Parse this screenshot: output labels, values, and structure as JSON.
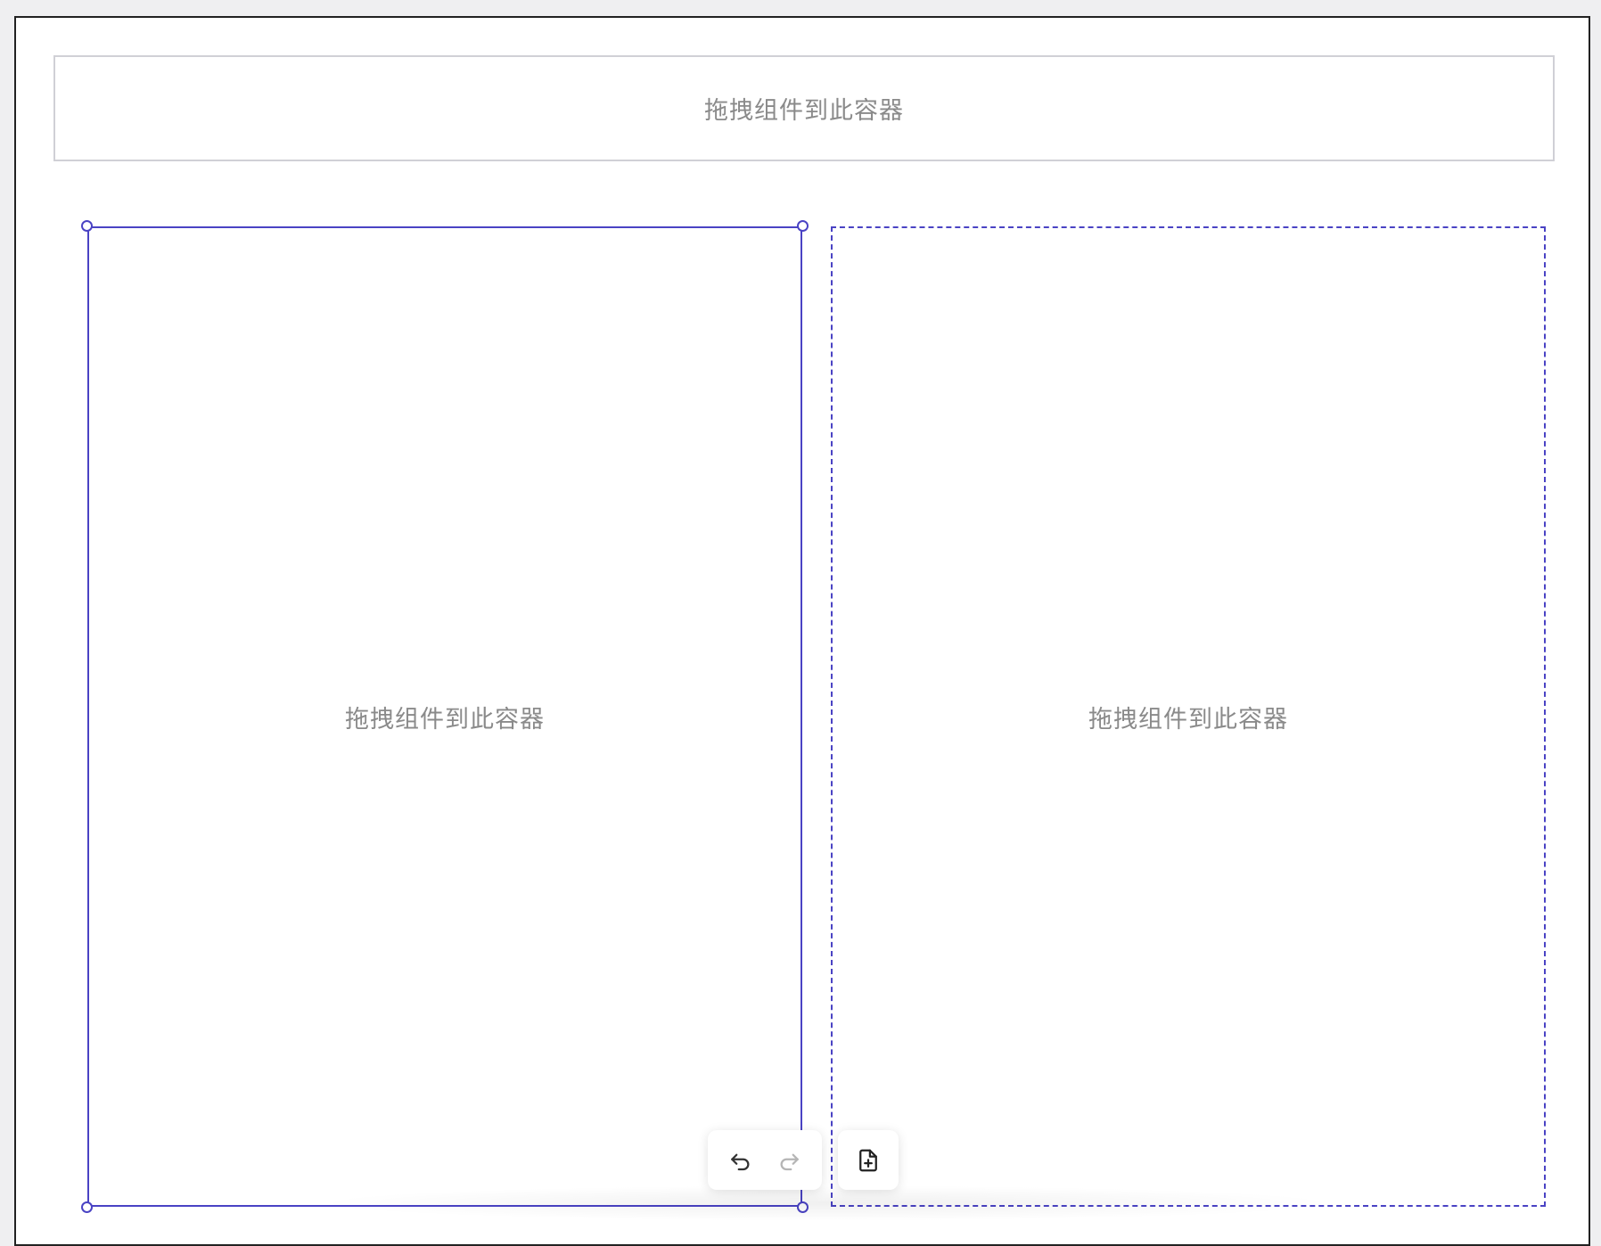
{
  "canvas": {
    "top_container": {
      "placeholder": "拖拽组件到此容器"
    },
    "columns": [
      {
        "placeholder": "拖拽组件到此容器",
        "selected": true
      },
      {
        "placeholder": "拖拽组件到此容器",
        "selected": false
      }
    ]
  },
  "toolbar": {
    "undo": {
      "icon": "undo-icon",
      "enabled": true
    },
    "redo": {
      "icon": "redo-icon",
      "enabled": false
    },
    "add_page": {
      "icon": "file-plus-icon"
    }
  },
  "colors": {
    "selection": "#4a43c4",
    "placeholder_text": "#8a8a8a",
    "top_border": "#d0d0d6",
    "background": "#efeff1"
  }
}
